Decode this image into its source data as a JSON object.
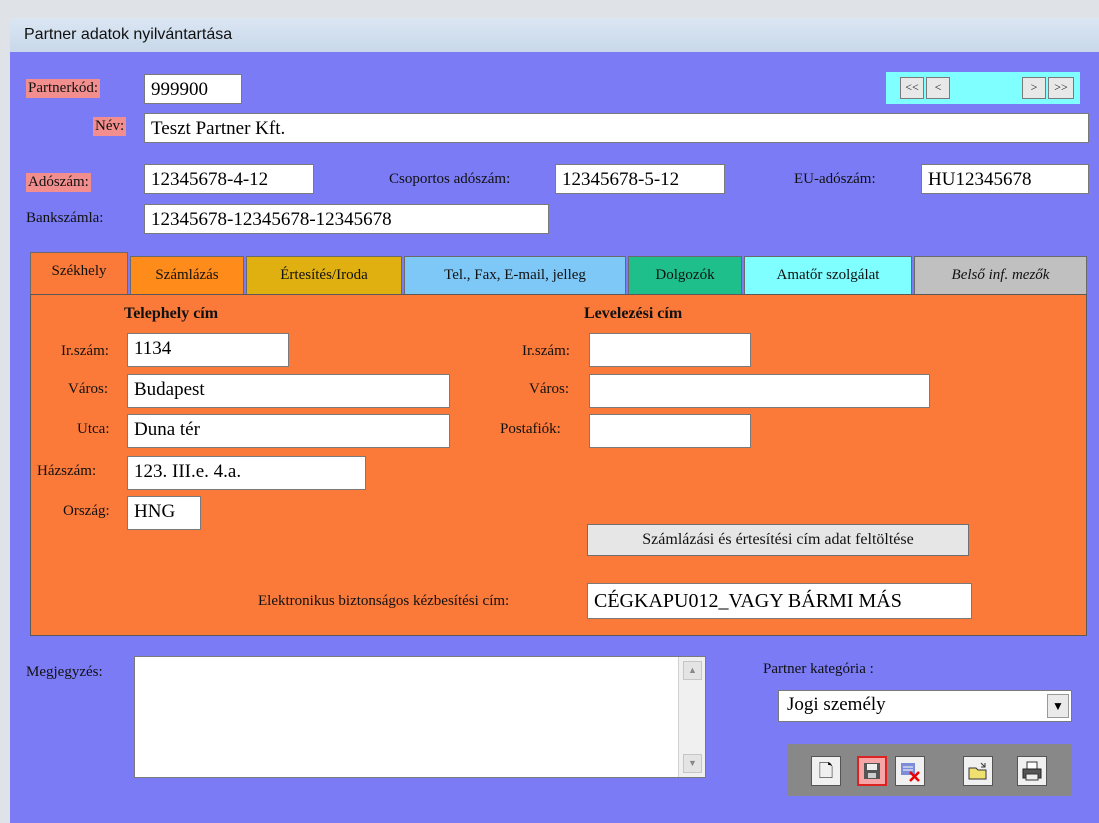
{
  "window": {
    "title": "Partner adatok nyilvántartása"
  },
  "nav": {
    "first": "<<",
    "prev": "<",
    "next": ">",
    "last": ">>"
  },
  "header": {
    "partner_code_label": "Partnerkód:",
    "partner_code": "999900",
    "name_label": "Név:",
    "name": "Teszt Partner Kft.",
    "tax_label": "Adószám:",
    "tax": "12345678-4-12",
    "group_tax_label": "Csoportos adószám:",
    "group_tax": "12345678-5-12",
    "eu_tax_label": "EU-adószám:",
    "eu_tax": "HU12345678",
    "bank_label": "Bankszámla:",
    "bank": "12345678-12345678-12345678"
  },
  "tabs": [
    {
      "label": "Székhely",
      "color": "#fb7a3a"
    },
    {
      "label": "Számlázás",
      "color": "#ff8c1a"
    },
    {
      "label": "Értesítés/Iroda",
      "color": "#e0b010"
    },
    {
      "label": "Tel., Fax, E-mail, jelleg",
      "color": "#7ec8f8"
    },
    {
      "label": "Dolgozók",
      "color": "#1fbf8c"
    },
    {
      "label": "Amatőr szolgálat",
      "color": "#7fffff"
    },
    {
      "label": "Belső inf. mezők",
      "color": "#c0c0c0"
    }
  ],
  "site": {
    "heading": "Telephely cím",
    "zip_label": "Ir.szám:",
    "zip": "1134",
    "city_label": "Város:",
    "city": "Budapest",
    "street_label": "Utca:",
    "street": "Duna tér",
    "house_label": "Házszám:",
    "house": "123. III.e. 4.a.",
    "country_label": "Ország:",
    "country": "HNG"
  },
  "mail": {
    "heading": "Levelezési cím",
    "zip_label": "Ir.szám:",
    "zip": "",
    "city_label": "Város:",
    "city": "",
    "pobox_label": "Postafiók:",
    "pobox": ""
  },
  "fill_button": "Számlázási és értesítési cím adat feltöltése",
  "ekaddr_label": "Elektronikus biztonságos kézbesítési cím:",
  "ekaddr": "CÉGKAPU012_VAGY BÁRMI MÁS",
  "note_label": "Megjegyzés:",
  "note": "",
  "category_label": "Partner kategória :",
  "category": "Jogi személy",
  "toolbar": [
    "new-icon",
    "save-icon",
    "delete-icon",
    "open-icon",
    "print-icon"
  ]
}
